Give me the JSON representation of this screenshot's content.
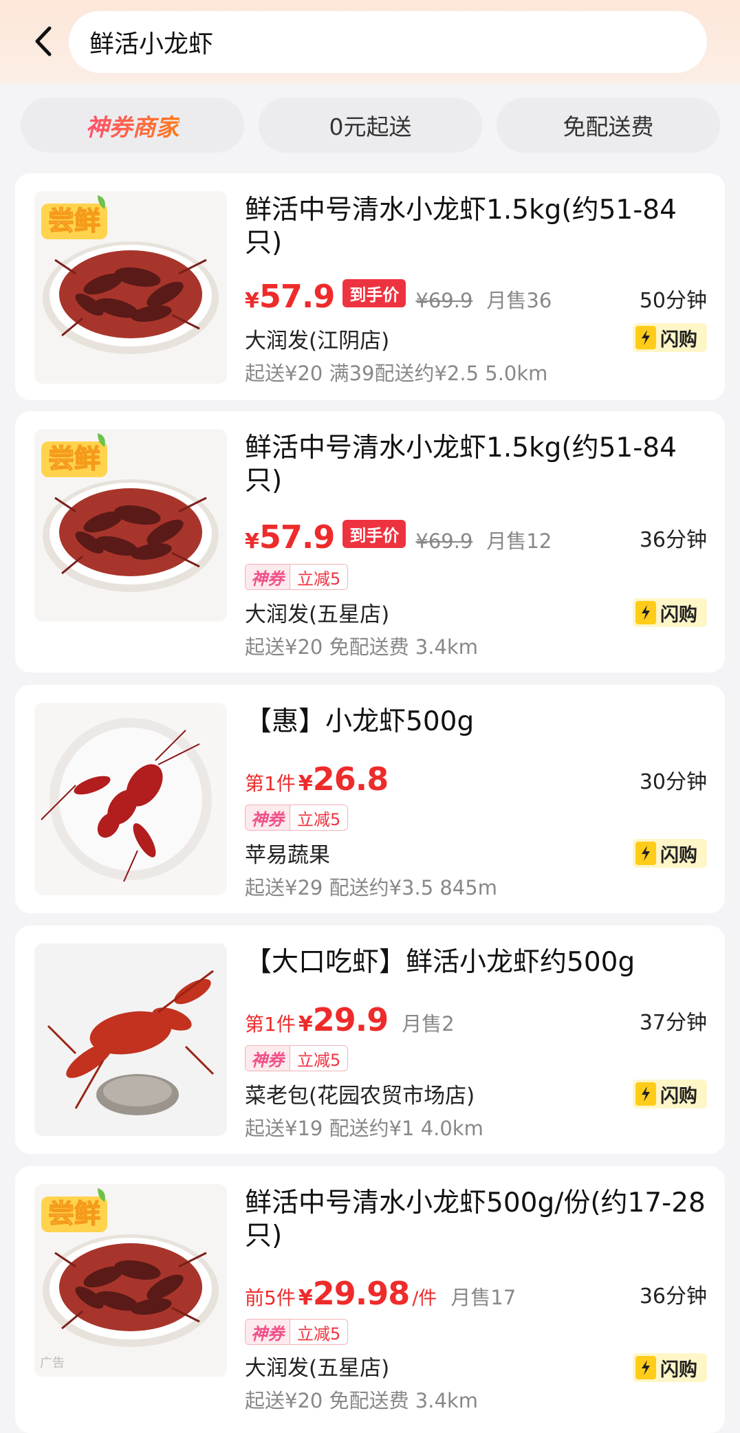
{
  "search": {
    "query": "鲜活小龙虾"
  },
  "filters": [
    {
      "label": "神券商家"
    },
    {
      "label": "0元起送"
    },
    {
      "label": "免配送费"
    }
  ],
  "badge_text": "尝鲜",
  "ad_mark": "广告",
  "flash_label": "闪购",
  "products": [
    {
      "title": "鲜活中号清水小龙虾1.5kg(约51-84只)",
      "price_prefix": "",
      "yen": "¥",
      "price": "57.9",
      "price_unit": "",
      "tag": "到手价",
      "orig_price": "¥69.9",
      "sold": "月售36",
      "coupon_brand": "",
      "coupon_value": "",
      "time": "50分钟",
      "store": "大润发(江阴店)",
      "delivery": "起送¥20  满39配送约¥2.5  5.0km",
      "image": "plate-badge"
    },
    {
      "title": "鲜活中号清水小龙虾1.5kg(约51-84只)",
      "price_prefix": "",
      "yen": "¥",
      "price": "57.9",
      "price_unit": "",
      "tag": "到手价",
      "orig_price": "¥69.9",
      "sold": "月售12",
      "coupon_brand": "神券",
      "coupon_value": "立减5",
      "time": "36分钟",
      "store": "大润发(五星店)",
      "delivery": "起送¥20  免配送费  3.4km",
      "image": "plate-badge"
    },
    {
      "title": "【惠】小龙虾500g",
      "price_prefix": "第1件",
      "yen": "¥",
      "price": "26.8",
      "price_unit": "",
      "tag": "",
      "orig_price": "",
      "sold": "",
      "coupon_brand": "神券",
      "coupon_value": "立减5",
      "time": "30分钟",
      "store": "苹易蔬果",
      "delivery": "起送¥29  配送约¥3.5  845m",
      "image": "single-crayfish"
    },
    {
      "title": "【大口吃虾】鲜活小龙虾约500g",
      "price_prefix": "第1件",
      "yen": "¥",
      "price": "29.9",
      "price_unit": "",
      "tag": "",
      "orig_price": "",
      "sold": "月售2",
      "coupon_brand": "神券",
      "coupon_value": "立减5",
      "time": "37分钟",
      "store": "菜老包(花园农贸市场店)",
      "delivery": "起送¥19  配送约¥1  4.0km",
      "image": "rock-crayfish"
    },
    {
      "title": "鲜活中号清水小龙虾500g/份(约17-28只)",
      "price_prefix": "前5件",
      "yen": "¥",
      "price": "29.98",
      "price_unit": "/件",
      "tag": "",
      "orig_price": "",
      "sold": "月售17",
      "coupon_brand": "神券",
      "coupon_value": "立减5",
      "time": "36分钟",
      "store": "大润发(五星店)",
      "delivery": "起送¥20  免配送费  3.4km",
      "image": "plate-badge"
    }
  ],
  "colors": {
    "accent": "#ee2b2b",
    "header_bg": "#fde7d9",
    "flash_bg": "#fff6c8"
  }
}
